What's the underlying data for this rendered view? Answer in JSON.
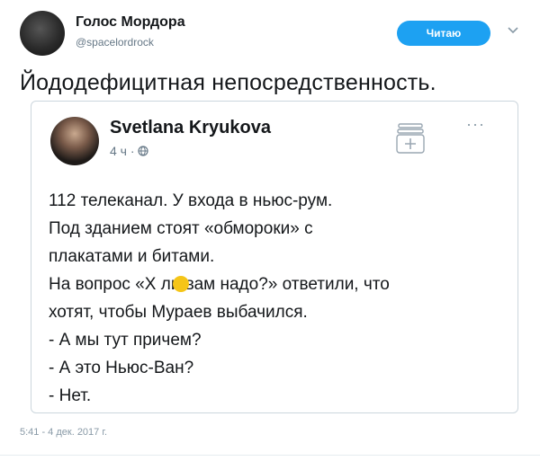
{
  "header": {
    "display_name": "Голос Мордора",
    "handle": "@spacelordrock",
    "follow_label": "Читаю"
  },
  "tweet": {
    "text": "Йододефицитная непосредственность.",
    "timestamp": "5:41 - 4 дек. 2017 г."
  },
  "quoted": {
    "name": "Svetlana Kryukova",
    "meta": "4 ч · ",
    "more": "···",
    "lines": [
      "112 телеканал. У входа в ньюс-рум.",
      "Под зданием стоят «обмороки» с",
      "плакатами и битами.",
      "На вопрос «Х ли вам надо?» ответили, что",
      "хотят, чтобы Мураев выбачился.",
      "- А мы тут причем?",
      "- А это Ньюс-Ван?",
      "- Нет."
    ]
  },
  "colors": {
    "accent": "#1da1f2",
    "text": "#14171a",
    "muted": "#657786",
    "border": "#ccd6dd",
    "censor_emoji": "#f5c518"
  },
  "icons": {
    "caret": "chevron-down-icon",
    "add_folder": "add-folder-icon",
    "globe": "globe-icon"
  }
}
